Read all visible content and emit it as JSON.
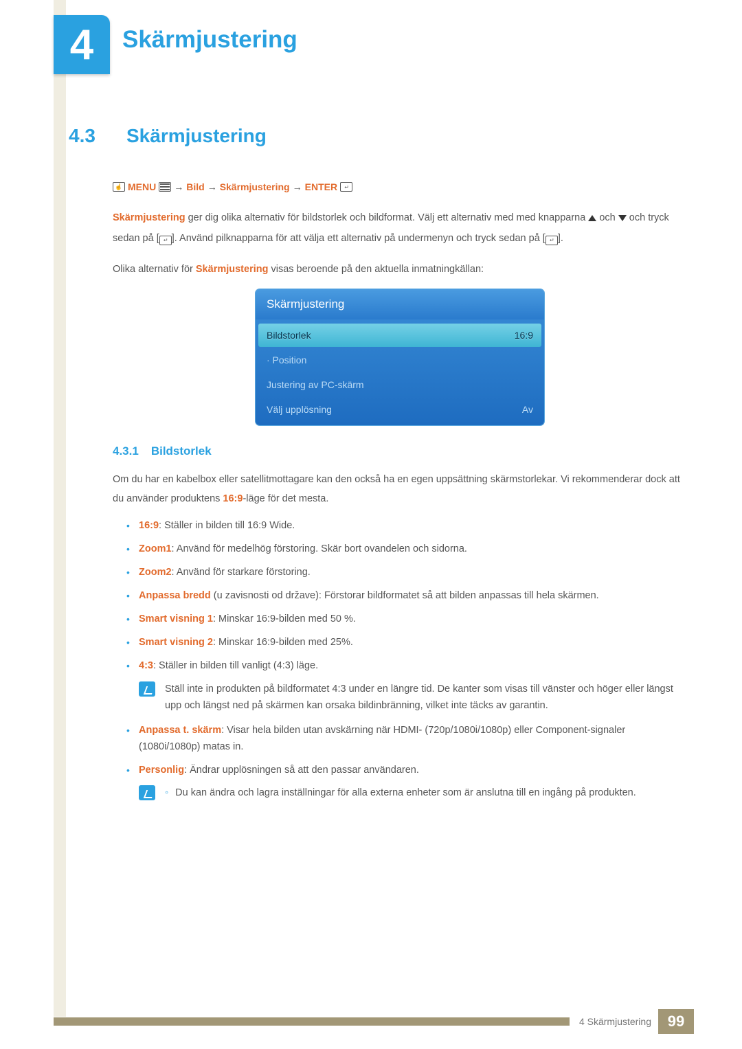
{
  "chapter": {
    "number": "4",
    "title": "Skärmjustering"
  },
  "section": {
    "number": "4.3",
    "title": "Skärmjustering"
  },
  "nav": {
    "menu": "MENU",
    "arrow": "→",
    "step1": "Bild",
    "step2": "Skärmjustering",
    "enter": "ENTER"
  },
  "body": {
    "p1_part1": "Skärmjustering",
    "p1_rest": " ger dig olika alternativ för bildstorlek och bildformat. Välj ett alternativ med med knapparna ",
    "p1_mid": " och ",
    "p1_after": " och tryck sedan på [",
    "p1_tail": "]. Använd pilknapparna för att välja ett alternativ på undermenyn och tryck sedan på [",
    "p1_end": "].",
    "p2_pre": "Olika alternativ för ",
    "p2_brand": "Skärmjustering",
    "p2_post": " visas beroende på den aktuella inmatningkällan:"
  },
  "osd": {
    "title": "Skärmjustering",
    "rows": [
      {
        "label": "Bildstorlek",
        "value": "16:9",
        "selected": true
      },
      {
        "label": "· Position",
        "value": "",
        "selected": false
      },
      {
        "label": "Justering av PC-skärm",
        "value": "",
        "selected": false
      },
      {
        "label": "Välj upplösning",
        "value": "Av",
        "selected": false
      }
    ]
  },
  "subsection": {
    "number": "4.3.1",
    "title": "Bildstorlek"
  },
  "sub_intro_pre": "Om du har en kabelbox eller satellitmottagare kan den också ha en egen uppsättning skärmstorlekar. Vi rekommenderar dock att du använder produktens ",
  "sub_intro_brand": "16:9",
  "sub_intro_post": "-läge för det mesta.",
  "bullets": [
    {
      "brand": "16:9",
      "text": ": Ställer in bilden till 16:9 Wide."
    },
    {
      "brand": "Zoom1",
      "text": ": Använd för medelhög förstoring. Skär bort ovandelen och sidorna."
    },
    {
      "brand": "Zoom2",
      "text": ": Använd för starkare förstoring."
    },
    {
      "brand": "Anpassa bredd",
      "text": " (u zavisnosti od države): Förstorar bildformatet så att bilden anpassas till hela skärmen."
    },
    {
      "brand": "Smart visning 1",
      "text": ": Minskar 16:9-bilden med 50 %."
    },
    {
      "brand": "Smart visning 2",
      "text": ": Minskar 16:9-bilden med 25%."
    },
    {
      "brand": "4:3",
      "text": ": Ställer in bilden till vanligt (4:3) läge."
    }
  ],
  "note1": "Ställ inte in produkten på bildformatet 4:3 under en längre tid. De kanter som visas till vänster och höger eller längst upp och längst ned på skärmen kan orsaka bildinbränning, vilket inte täcks av garantin.",
  "bullets2": [
    {
      "brand": "Anpassa t. skärm",
      "text": ": Visar hela bilden utan avskärning när HDMI- (720p/1080i/1080p) eller Component-signaler (1080i/1080p) matas in."
    },
    {
      "brand": "Personlig",
      "text": ": Ändrar upplösningen så att den passar användaren."
    }
  ],
  "note2": "Du kan ändra och lagra inställningar för alla externa enheter som är anslutna till en ingång på produkten.",
  "footer": {
    "label": "4 Skärmjustering",
    "page": "99"
  }
}
